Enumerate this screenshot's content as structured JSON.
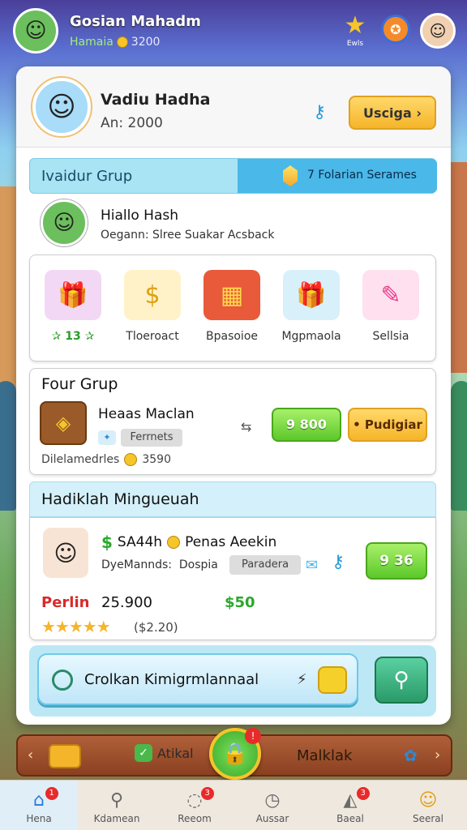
{
  "header": {
    "player_name": "Gosian Mahadm",
    "player_sub": "Hamaia",
    "player_coins": "3200",
    "star_label": "Ewls"
  },
  "profile": {
    "name": "Vadiu Hadha",
    "level": "An: 2000",
    "button": "Usciga ›"
  },
  "group_bar": {
    "title": "Ivaidur Grup",
    "right_text": "7 Folarian Serames"
  },
  "group_user": {
    "name": "Hiallo Hash",
    "desc": "Oegann: Slree Suakar Acsback"
  },
  "items": [
    {
      "label": "13",
      "icon": "gift-boxes-icon"
    },
    {
      "label": "Tloeroact",
      "icon": "coin-stack-icon"
    },
    {
      "label": "Bpasoioe",
      "icon": "red-chest-icon"
    },
    {
      "label": "Mgpmaola",
      "icon": "gift-box-icon"
    },
    {
      "label": "Sellsia",
      "icon": "ticket-icon"
    }
  ],
  "four_group": {
    "title": "Four Grup",
    "item_name": "Heaas Maclan",
    "tag": "Ferrnets",
    "green_button": "9 800",
    "orange_button": "• Pudigiar",
    "footer_label": "Dilelamedrles",
    "footer_value": "3590"
  },
  "hadiah": {
    "title": "Hadiklah Mingueuah",
    "line1_amount": "SA44h",
    "line1_text": "Penas Aeekin",
    "line2_text": "DyeMannds:",
    "line2_word": "Dospia",
    "tag": "Paradera",
    "green_button": "9 36",
    "price_label": "Perlin",
    "price_value": "25.900",
    "price_green": "$50",
    "stars": "★★★★★",
    "stars_value": "($2.20)"
  },
  "cta": {
    "label": "Crolkan Kimigrmlannaal"
  },
  "lower_bar": {
    "action_label": "Atikal",
    "right_name": "Malklak"
  },
  "nav": [
    {
      "label": "Hena",
      "icon": "home-icon",
      "badge": "1",
      "active": true
    },
    {
      "label": "Kdamean",
      "icon": "search-icon",
      "badge": "",
      "active": false
    },
    {
      "label": "Reeom",
      "icon": "chat-icon",
      "badge": "3",
      "active": false
    },
    {
      "label": "Aussar",
      "icon": "clock-icon",
      "badge": "",
      "active": false
    },
    {
      "label": "Baeal",
      "icon": "bag-icon",
      "badge": "3",
      "active": false
    },
    {
      "label": "Seeral",
      "icon": "smile-icon",
      "badge": "",
      "active": false
    }
  ]
}
